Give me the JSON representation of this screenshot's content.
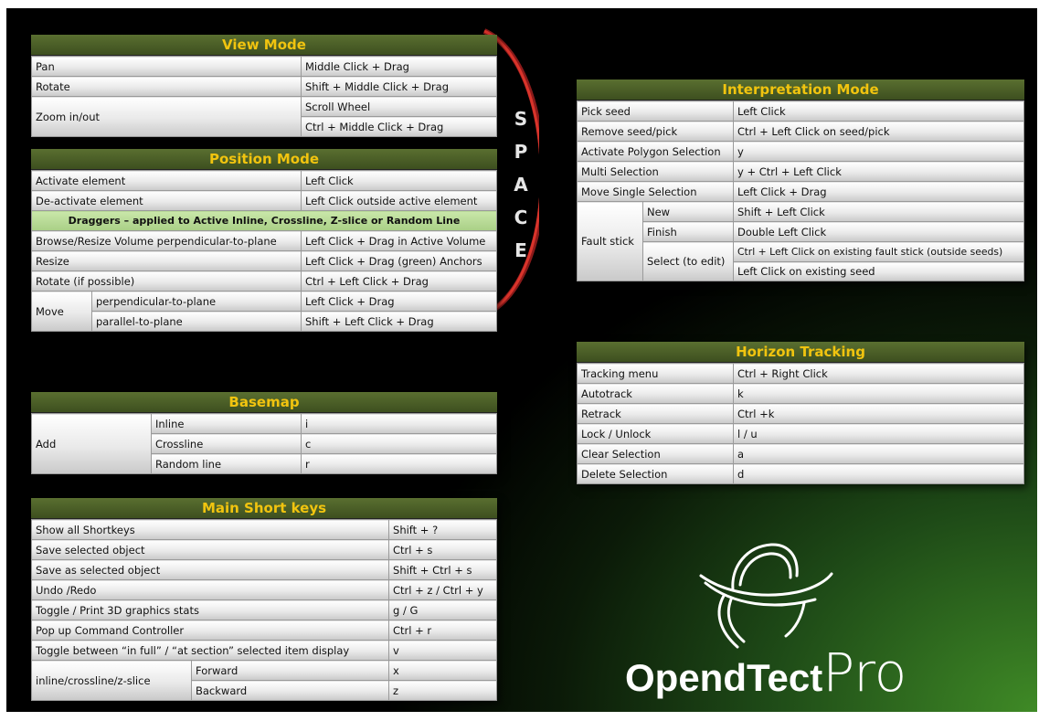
{
  "view_mode": {
    "title": "View Mode",
    "rows": [
      [
        "Pan",
        "Middle Click + Drag"
      ],
      [
        "Rotate",
        "Shift + Middle Click + Drag"
      ]
    ],
    "zoom_label": "Zoom in/out",
    "zoom_values": [
      "Scroll Wheel",
      "Ctrl + Middle Click + Drag"
    ]
  },
  "position_mode": {
    "title": "Position Mode",
    "rows_top": [
      [
        "Activate element",
        "Left Click"
      ],
      [
        "De-activate element",
        "Left Click outside active element"
      ]
    ],
    "draggers_note": "Draggers – applied to Active Inline, Crossline, Z-slice or Random Line",
    "rows_mid": [
      [
        "Browse/Resize Volume perpendicular-to-plane",
        "Left Click + Drag in Active Volume"
      ],
      [
        "Resize",
        "Left Click + Drag (green) Anchors"
      ],
      [
        "Rotate (if possible)",
        "Ctrl  + Left Click + Drag"
      ]
    ],
    "move_label": "Move",
    "move_rows": [
      [
        "perpendicular-to-plane",
        "Left Click + Drag"
      ],
      [
        "parallel-to-plane",
        "Shift + Left Click + Drag"
      ]
    ]
  },
  "space_letters": [
    "S",
    "P",
    "A",
    "C",
    "E"
  ],
  "interpretation_mode": {
    "title": "Interpretation Mode",
    "rows": [
      [
        "Pick seed",
        "Left Click"
      ],
      [
        "Remove seed/pick",
        "Ctrl + Left Click on seed/pick"
      ],
      [
        "Activate Polygon Selection",
        "y"
      ],
      [
        "Multi Selection",
        "y + Ctrl + Left Click"
      ],
      [
        "Move Single Selection",
        "Left Click + Drag"
      ]
    ],
    "fault_label": "Fault stick",
    "fault_new": [
      "New",
      "Shift + Left Click"
    ],
    "fault_finish": [
      "Finish",
      "Double Left Click"
    ],
    "fault_select_label": "Select (to edit)",
    "fault_select_values": [
      "Ctrl + Left Click on existing fault stick (outside seeds)",
      "Left Click on existing seed"
    ]
  },
  "horizon_tracking": {
    "title": "Horizon Tracking",
    "rows": [
      [
        "Tracking menu",
        "Ctrl + Right Click"
      ],
      [
        "Autotrack",
        "k"
      ],
      [
        "Retrack",
        "Ctrl +k"
      ],
      [
        "Lock / Unlock",
        "l / u"
      ],
      [
        "Clear Selection",
        "a"
      ],
      [
        "Delete Selection",
        "d"
      ]
    ]
  },
  "basemap": {
    "title": "Basemap",
    "add_label": "Add",
    "rows": [
      [
        "Inline",
        "i"
      ],
      [
        "Crossline",
        "c"
      ],
      [
        "Random line",
        "r"
      ]
    ]
  },
  "main_short_keys": {
    "title": "Main Short keys",
    "rows": [
      [
        "Show all Shortkeys",
        "Shift + ?"
      ],
      [
        "Save selected object",
        "Ctrl + s"
      ],
      [
        "Save as selected object",
        "Shift + Ctrl + s"
      ],
      [
        "Undo /Redo",
        "Ctrl + z / Ctrl + y"
      ],
      [
        "Toggle / Print 3D graphics stats",
        "g / G"
      ],
      [
        "Pop up Command Controller",
        "Ctrl + r"
      ],
      [
        "Toggle between  “in full” / “at section” selected item display",
        "v"
      ]
    ],
    "slice_label": "inline/crossline/z-slice",
    "slice_rows": [
      [
        "Forward",
        "x"
      ],
      [
        "Backward",
        "z"
      ]
    ]
  },
  "logo": {
    "text_bold": "OpendTect",
    "text_light": "Pro"
  },
  "colors": {
    "title_text": "#f1c40f",
    "header_bg": "#4a5e27",
    "arc": "#c0392b",
    "draggers_bar": "#b5d895"
  }
}
